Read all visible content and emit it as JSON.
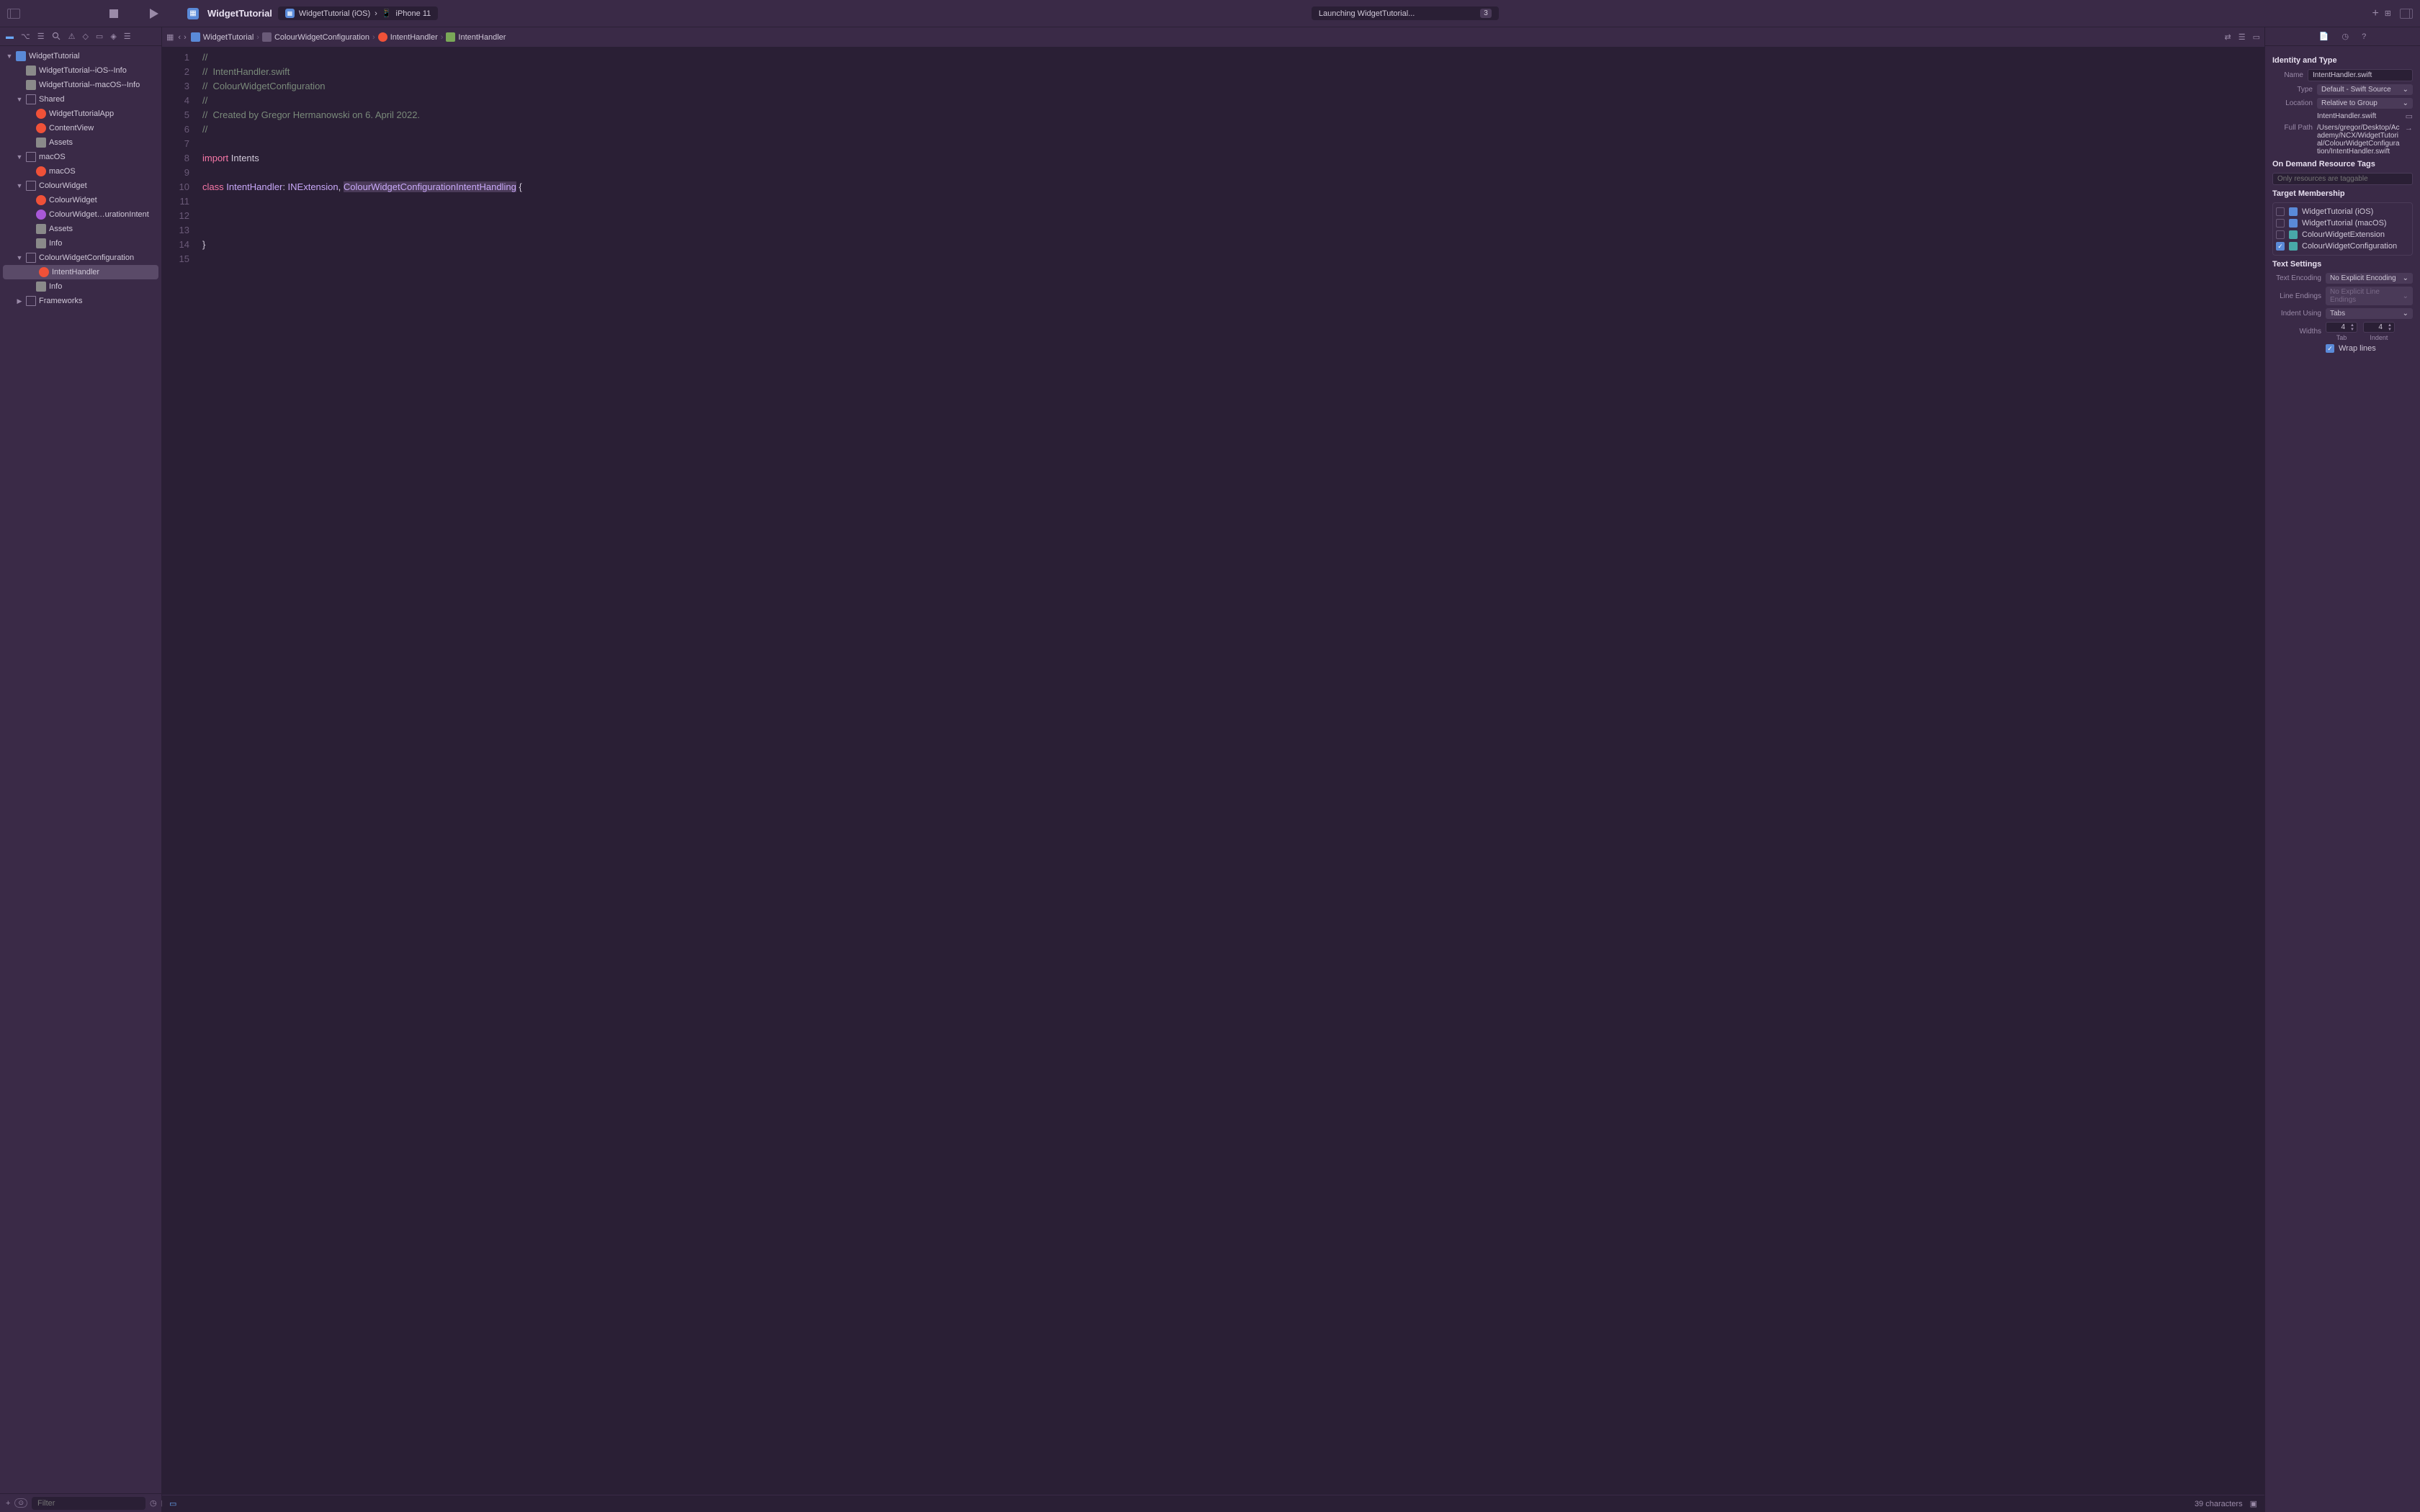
{
  "toolbar": {
    "project_name": "WidgetTutorial",
    "scheme": "WidgetTutorial (iOS)",
    "device": "iPhone 11",
    "status": "Launching WidgetTutorial...",
    "issue_count": "3"
  },
  "breadcrumb": {
    "items": [
      {
        "label": "WidgetTutorial",
        "icon": "blue"
      },
      {
        "label": "ColourWidgetConfiguration",
        "icon": "folder"
      },
      {
        "label": "IntentHandler",
        "icon": "swift"
      },
      {
        "label": "IntentHandler",
        "icon": "class"
      }
    ]
  },
  "sidebar": {
    "filter_placeholder": "Filter",
    "tree": [
      {
        "d": 0,
        "label": "WidgetTutorial",
        "icon": "proj",
        "open": true
      },
      {
        "d": 1,
        "label": "WidgetTutorial--iOS--Info",
        "icon": "plist"
      },
      {
        "d": 1,
        "label": "WidgetTutorial--macOS--Info",
        "icon": "plist"
      },
      {
        "d": 1,
        "label": "Shared",
        "icon": "folder",
        "open": true
      },
      {
        "d": 2,
        "label": "WidgetTutorialApp",
        "icon": "swift"
      },
      {
        "d": 2,
        "label": "ContentView",
        "icon": "swift"
      },
      {
        "d": 2,
        "label": "Assets",
        "icon": "assets"
      },
      {
        "d": 1,
        "label": "macOS",
        "icon": "folder",
        "open": true
      },
      {
        "d": 2,
        "label": "macOS",
        "icon": "swift"
      },
      {
        "d": 1,
        "label": "ColourWidget",
        "icon": "folder",
        "open": true
      },
      {
        "d": 2,
        "label": "ColourWidget",
        "icon": "swift"
      },
      {
        "d": 2,
        "label": "ColourWidget…urationIntent",
        "icon": "intent"
      },
      {
        "d": 2,
        "label": "Assets",
        "icon": "assets"
      },
      {
        "d": 2,
        "label": "Info",
        "icon": "plist"
      },
      {
        "d": 1,
        "label": "ColourWidgetConfiguration",
        "icon": "folder",
        "open": true
      },
      {
        "d": 2,
        "label": "IntentHandler",
        "icon": "swift",
        "selected": true
      },
      {
        "d": 2,
        "label": "Info",
        "icon": "plist"
      },
      {
        "d": 1,
        "label": "Frameworks",
        "icon": "folder",
        "open": false
      }
    ]
  },
  "code": {
    "lines": [
      {
        "n": 1,
        "segs": [
          {
            "t": "//",
            "c": "comment"
          }
        ]
      },
      {
        "n": 2,
        "segs": [
          {
            "t": "//  IntentHandler.swift",
            "c": "comment"
          }
        ]
      },
      {
        "n": 3,
        "segs": [
          {
            "t": "//  ColourWidgetConfiguration",
            "c": "comment"
          }
        ]
      },
      {
        "n": 4,
        "segs": [
          {
            "t": "//",
            "c": "comment"
          }
        ]
      },
      {
        "n": 5,
        "segs": [
          {
            "t": "//  Created by Gregor Hermanowski on 6. April 2022.",
            "c": "comment"
          }
        ]
      },
      {
        "n": 6,
        "segs": [
          {
            "t": "//",
            "c": "comment"
          }
        ]
      },
      {
        "n": 7,
        "segs": [
          {
            "t": "",
            "c": ""
          }
        ]
      },
      {
        "n": 8,
        "segs": [
          {
            "t": "import",
            "c": "keyword"
          },
          {
            "t": " Intents",
            "c": ""
          }
        ]
      },
      {
        "n": 9,
        "segs": [
          {
            "t": "",
            "c": ""
          }
        ]
      },
      {
        "n": 10,
        "segs": [
          {
            "t": "class",
            "c": "keyword"
          },
          {
            "t": " ",
            "c": ""
          },
          {
            "t": "IntentHandler",
            "c": "type"
          },
          {
            "t": ": ",
            "c": ""
          },
          {
            "t": "INExtension",
            "c": "type"
          },
          {
            "t": ", ",
            "c": ""
          },
          {
            "t": "ColourWidgetConfigurationIntentHandling",
            "c": "type selected"
          },
          {
            "t": " {",
            "c": ""
          }
        ]
      },
      {
        "n": 11,
        "segs": [
          {
            "t": "",
            "c": ""
          }
        ]
      },
      {
        "n": 12,
        "segs": [
          {
            "t": "",
            "c": ""
          }
        ]
      },
      {
        "n": 13,
        "segs": [
          {
            "t": "",
            "c": ""
          }
        ]
      },
      {
        "n": 14,
        "segs": [
          {
            "t": "}",
            "c": ""
          }
        ]
      },
      {
        "n": 15,
        "segs": [
          {
            "t": "",
            "c": ""
          }
        ]
      }
    ]
  },
  "editor_footer": {
    "status": "39 characters"
  },
  "inspector": {
    "identity_title": "Identity and Type",
    "name_label": "Name",
    "name_value": "IntentHandler.swift",
    "type_label": "Type",
    "type_value": "Default - Swift Source",
    "location_label": "Location",
    "location_value": "Relative to Group",
    "location_file": "IntentHandler.swift",
    "fullpath_label": "Full Path",
    "fullpath_value": "/Users/gregor/Desktop/Academy/NCX/WidgetTutorial/ColourWidgetConfiguration/IntentHandler.swift",
    "ondemand_title": "On Demand Resource Tags",
    "ondemand_placeholder": "Only resources are taggable",
    "target_title": "Target Membership",
    "targets": [
      {
        "label": "WidgetTutorial (iOS)",
        "checked": false,
        "icon": "app"
      },
      {
        "label": "WidgetTutorial (macOS)",
        "checked": false,
        "icon": "app"
      },
      {
        "label": "ColourWidgetExtension",
        "checked": false,
        "icon": "ext"
      },
      {
        "label": "ColourWidgetConfiguration",
        "checked": true,
        "icon": "ext"
      }
    ],
    "text_title": "Text Settings",
    "encoding_label": "Text Encoding",
    "encoding_value": "No Explicit Encoding",
    "lineend_label": "Line Endings",
    "lineend_value": "No Explicit Line Endings",
    "indent_label": "Indent Using",
    "indent_value": "Tabs",
    "widths_label": "Widths",
    "tab_width": "4",
    "tab_sublabel": "Tab",
    "indent_width": "4",
    "indent_sublabel": "Indent",
    "wrap_label": "Wrap lines",
    "wrap_checked": true
  }
}
